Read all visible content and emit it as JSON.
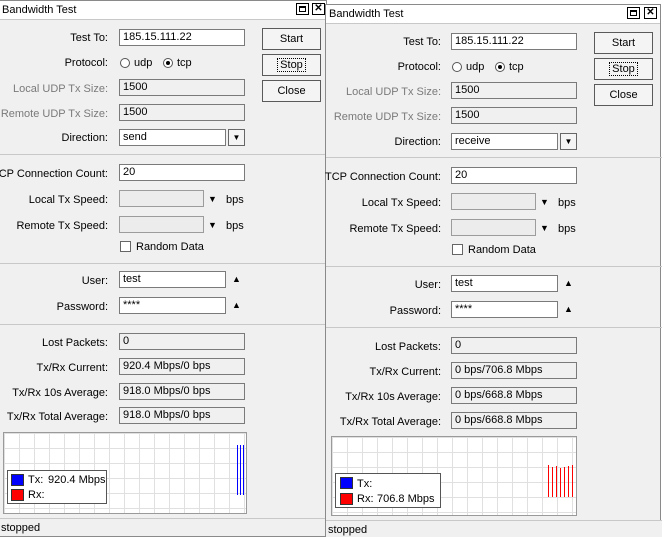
{
  "left": {
    "title": "Bandwidth Test",
    "labels": {
      "test_to": "Test To:",
      "protocol": "Protocol:",
      "local_udp": "Local UDP Tx Size:",
      "remote_udp": "Remote UDP Tx Size:",
      "direction": "Direction:",
      "tcp_count": "TCP Connection Count:",
      "local_speed": "Local Tx Speed:",
      "remote_speed": "Remote Tx Speed:",
      "user": "User:",
      "password": "Password:",
      "lost": "Lost Packets:",
      "current": "Tx/Rx Current:",
      "avg10": "Tx/Rx 10s Average:",
      "total": "Tx/Rx Total Average:"
    },
    "values": {
      "test_to": "185.15.111.22",
      "udp": "udp",
      "tcp": "tcp",
      "local_udp": "1500",
      "remote_udp": "1500",
      "direction": "send",
      "tcp_count": "20",
      "local_speed": "",
      "remote_speed": "",
      "bps": "bps",
      "random_data": "Random Data",
      "user": "test",
      "password": "****",
      "lost": "0",
      "current": "920.4 Mbps/0 bps",
      "avg10": "918.0 Mbps/0 bps",
      "total": "918.0 Mbps/0 bps"
    },
    "buttons": {
      "start": "Start",
      "stop": "Stop",
      "close": "Close"
    },
    "legend": {
      "tx_label": "Tx:",
      "tx_value": "920.4 Mbps",
      "rx_label": "Rx:",
      "rx_value": ""
    },
    "status": "stopped",
    "colors": {
      "tx": "#0000ff",
      "rx": "#ff0000"
    }
  },
  "right": {
    "title": "Bandwidth Test",
    "labels": {
      "test_to": "Test To:",
      "protocol": "Protocol:",
      "local_udp": "Local UDP Tx Size:",
      "remote_udp": "Remote UDP Tx Size:",
      "direction": "Direction:",
      "tcp_count": "TCP Connection Count:",
      "local_speed": "Local Tx Speed:",
      "remote_speed": "Remote Tx Speed:",
      "user": "User:",
      "password": "Password:",
      "lost": "Lost Packets:",
      "current": "Tx/Rx Current:",
      "avg10": "Tx/Rx 10s Average:",
      "total": "Tx/Rx Total Average:"
    },
    "values": {
      "test_to": "185.15.111.22",
      "udp": "udp",
      "tcp": "tcp",
      "local_udp": "1500",
      "remote_udp": "1500",
      "direction": "receive",
      "tcp_count": "20",
      "local_speed": "",
      "remote_speed": "",
      "bps": "bps",
      "random_data": "Random Data",
      "user": "test",
      "password": "****",
      "lost": "0",
      "current": "0 bps/706.8 Mbps",
      "avg10": "0 bps/668.8 Mbps",
      "total": "0 bps/668.8 Mbps"
    },
    "buttons": {
      "start": "Start",
      "stop": "Stop",
      "close": "Close"
    },
    "legend": {
      "tx_label": "Tx:",
      "tx_value": "",
      "rx_label": "Rx:",
      "rx_value": "706.8 Mbps"
    },
    "status": "stopped",
    "colors": {
      "tx": "#0000ff",
      "rx": "#ff0000"
    }
  }
}
